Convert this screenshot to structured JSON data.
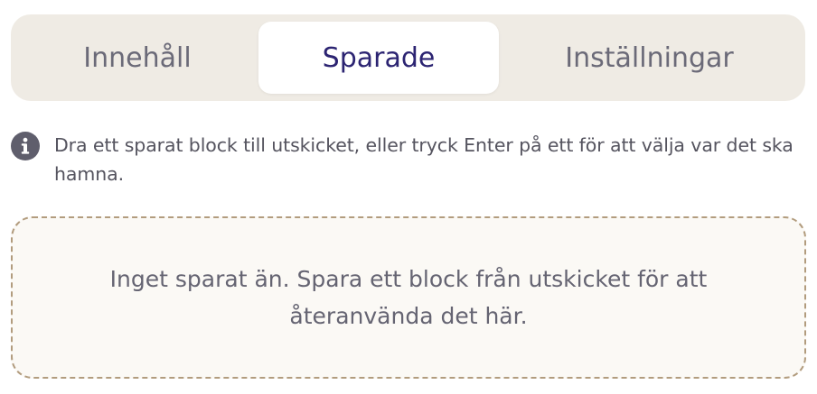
{
  "tabs": [
    {
      "label": "Innehåll",
      "selected": false
    },
    {
      "label": "Sparade",
      "selected": true
    },
    {
      "label": "Inställningar",
      "selected": false
    }
  ],
  "info": {
    "icon": "info-icon",
    "text": "Dra ett sparat block till utskicket, eller tryck Enter på ett för att välja var det ska hamna."
  },
  "empty_state": {
    "text": "Inget sparat än. Spara ett block från utskicket för att återanvända det här."
  },
  "colors": {
    "tabbar_bg": "#efebe4",
    "selected_tab_text": "#2c2472",
    "tab_text": "#6b6a78",
    "dropzone_border": "#b29c7e",
    "dropzone_bg": "#fbf9f5"
  }
}
